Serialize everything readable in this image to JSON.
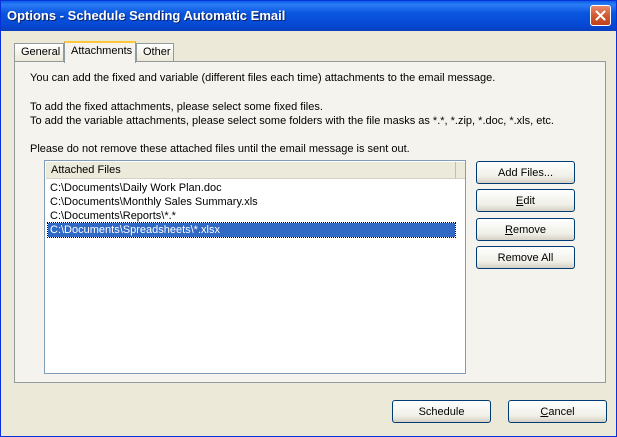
{
  "window": {
    "title": "Options - Schedule Sending Automatic Email"
  },
  "tabs": [
    {
      "label": "General",
      "active": false
    },
    {
      "label": "Attachments",
      "active": true
    },
    {
      "label": "Other",
      "active": false
    }
  ],
  "attachments": {
    "intro": "You can add the fixed and variable (different files each time) attachments to the email message.",
    "fixed_hint": "To add the fixed attachments, please select some fixed files.",
    "variable_hint": "To add the variable attachments, please select some folders with the file masks as *.*, *.zip, *.doc, *.xls, etc.",
    "warning": "Please do not remove these attached files until the email message is sent out.",
    "list_header": "Attached Files",
    "files": [
      {
        "path": "C:\\Documents\\Daily Work Plan.doc",
        "selected": false
      },
      {
        "path": "C:\\Documents\\Monthly Sales Summary.xls",
        "selected": false
      },
      {
        "path": "C:\\Documents\\Reports\\*.*",
        "selected": false
      },
      {
        "path": "C:\\Documents\\Spreadsheets\\*.xlsx",
        "selected": true
      }
    ]
  },
  "buttons": {
    "add_files": "Add Files...",
    "edit_first": "E",
    "edit_rest": "dit",
    "remove_first": "R",
    "remove_rest": "emove",
    "remove_all": "Remove All",
    "schedule": "Schedule",
    "cancel_first": "C",
    "cancel_rest": "ancel"
  },
  "colors": {
    "titlebar": "#0a56e0",
    "selection": "#316ac5",
    "active_tab_accent": "#ffc83c",
    "close_button": "#d25a35"
  }
}
